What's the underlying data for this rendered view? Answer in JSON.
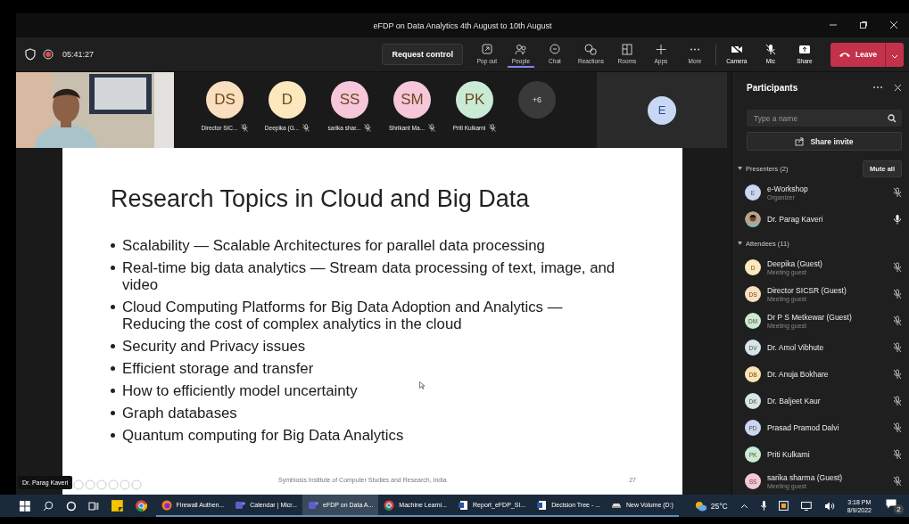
{
  "window": {
    "title": "eFDP on Data Analytics 4th August to 10th August"
  },
  "toolbar": {
    "timer": "05:41:27",
    "request_control": "Request control",
    "buttons": [
      {
        "kind": "popout",
        "label": "Pop out",
        "selected": false
      },
      {
        "kind": "people",
        "label": "People",
        "selected": true
      },
      {
        "kind": "chat",
        "label": "Chat",
        "selected": false
      },
      {
        "kind": "reactions",
        "label": "Reactions",
        "selected": false
      },
      {
        "kind": "rooms",
        "label": "Rooms",
        "selected": false
      },
      {
        "kind": "apps",
        "label": "Apps",
        "selected": false
      },
      {
        "kind": "more",
        "label": "More",
        "selected": false
      },
      {
        "kind": "camera",
        "label": "Camera",
        "selected": false
      },
      {
        "kind": "mic",
        "label": "Mic",
        "selected": false
      },
      {
        "kind": "share",
        "label": "Share",
        "selected": false
      }
    ],
    "leave": "Leave"
  },
  "gallery": {
    "avatars": [
      {
        "initials": "DS",
        "name": "Director SIC...",
        "color": "#f9dfc0"
      },
      {
        "initials": "D",
        "name": "Deepika (G...",
        "color": "#fbe9bd"
      },
      {
        "initials": "SS",
        "name": "sarika shar...",
        "color": "#f6c7da"
      },
      {
        "initials": "SM",
        "name": "Shrikant Ma...",
        "color": "#f6c7da"
      },
      {
        "initials": "PK",
        "name": "Priti Kulkarni",
        "color": "#c9ebd6"
      }
    ],
    "overflow": "+6",
    "tile": {
      "initials": "E",
      "color": "#c8d7f3"
    }
  },
  "slide": {
    "title": "Research Topics in Cloud and Big Data",
    "bullets": [
      "Scalability — Scalable Architectures for parallel data processing",
      "Real-time big data analytics — Stream data processing of text, image, and video",
      "Cloud Computing Platforms for Big Data Adoption and Analytics — Reducing the cost of complex analytics in the cloud",
      "Security and Privacy issues",
      "Efficient storage and transfer",
      "How to efficiently model uncertainty",
      "Graph databases",
      "Quantum computing for Big Data Analytics"
    ],
    "footer": "Symbiosis Institute of Computer Studies and Research, India",
    "page": "27",
    "speaker": "Dr. Parag Kaveri"
  },
  "participants": {
    "title": "Participants",
    "search": {
      "placeholder": "Type a name"
    },
    "share_invite": "Share invite",
    "sections": [
      {
        "label": "Presenters (2)",
        "expanded": true,
        "action": "Mute all",
        "members": [
          {
            "kind": "initials",
            "initials": "E",
            "name": "e-Workshop",
            "subtitle": "Organizer",
            "color": "#c8d7f3",
            "muted": true
          },
          {
            "name": "Dr. Parag Kaveri",
            "muted": false
          }
        ]
      },
      {
        "label": "Attendees (11)",
        "expanded": true,
        "members": [
          {
            "kind": "initials",
            "initials": "D",
            "name": "Deepika (Guest)",
            "subtitle": "Meeting guest",
            "color": "#fbe9bd",
            "muted": true
          },
          {
            "kind": "initials",
            "initials": "DS",
            "name": "Director SICSR (Guest)",
            "subtitle": "Meeting guest",
            "color": "#f9dfc0",
            "muted": true
          },
          {
            "kind": "initials",
            "initials": "DM",
            "name": "Dr P S Metkewar (Guest)",
            "subtitle": "Meeting guest",
            "color": "#c9ebd6",
            "muted": true
          },
          {
            "kind": "initials",
            "initials": "DV",
            "name": "Dr. Amol Vibhute",
            "color": "#d3e6ea",
            "muted": true
          },
          {
            "kind": "initials",
            "initials": "DB",
            "name": "Dr. Anuja Bokhare",
            "color": "#fbe3b3",
            "muted": true
          },
          {
            "kind": "initials",
            "initials": "DK",
            "name": "Dr. Baljeet Kaur",
            "color": "#d3e6ea",
            "muted": true
          },
          {
            "kind": "initials",
            "initials": "PD",
            "name": "Prasad Pramod Dalvi",
            "color": "#c8d7f3",
            "muted": true
          },
          {
            "kind": "initials",
            "initials": "PK",
            "name": "Priti Kulkarni",
            "color": "#c9ebd6",
            "muted": true
          },
          {
            "kind": "initials",
            "initials": "SS",
            "name": "sarika sharma (Guest)",
            "subtitle": "Meeting guest",
            "color": "#f6c7da",
            "muted": true
          }
        ]
      }
    ]
  },
  "taskbar": {
    "apps": [
      {
        "kind": "firefox",
        "label": "Firewall Authen...",
        "selected": false
      },
      {
        "kind": "teams",
        "label": "Calendar | Micr...",
        "selected": false
      },
      {
        "kind": "teams",
        "label": "eFDP on Data A...",
        "selected": true
      },
      {
        "kind": "chrome",
        "label": "Machine Learni...",
        "selected": false
      },
      {
        "kind": "word",
        "label": "Report_eFDP_SI...",
        "selected": false
      },
      {
        "kind": "word",
        "label": "Decision Tree - ...",
        "selected": false
      },
      {
        "kind": "drive",
        "label": "New Volume (D:)",
        "selected": false
      }
    ],
    "weather": "25°C",
    "time": "3:18 PM",
    "date": "8/9/2022",
    "notifications": "2"
  }
}
